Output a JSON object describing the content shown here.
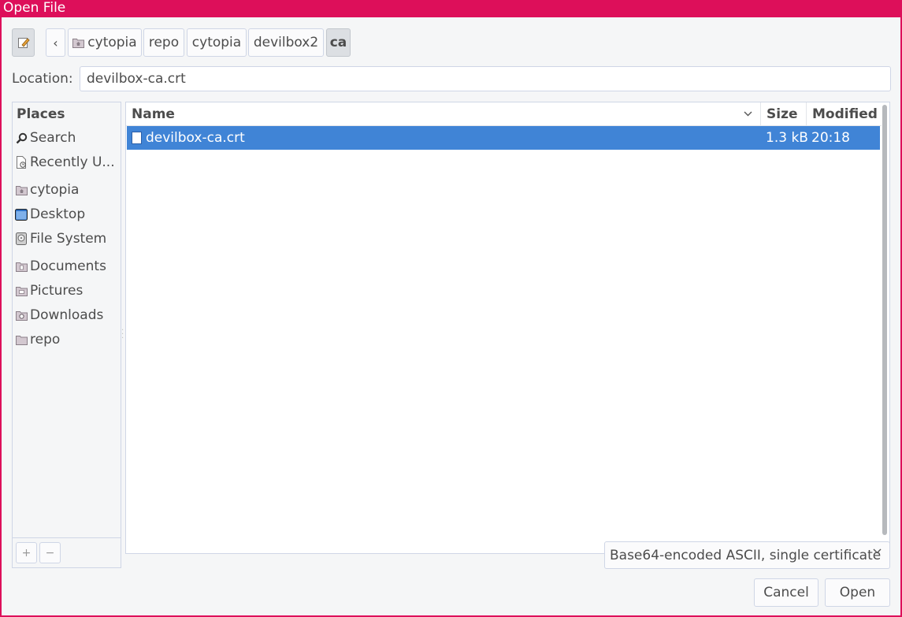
{
  "window": {
    "title": "Open File"
  },
  "pathbar": {
    "crumbs": [
      {
        "label": "cytopia",
        "icon": "home-folder-icon"
      },
      {
        "label": "repo"
      },
      {
        "label": "cytopia"
      },
      {
        "label": "devilbox2"
      },
      {
        "label": "ca"
      }
    ]
  },
  "location": {
    "label": "Location:",
    "value": "devilbox-ca.crt"
  },
  "sidebar": {
    "title": "Places",
    "items": [
      {
        "label": "Search",
        "icon": "search-icon"
      },
      {
        "label": "Recently U...",
        "icon": "recent-icon"
      },
      {
        "label": "cytopia",
        "icon": "home-folder-icon"
      },
      {
        "label": "Desktop",
        "icon": "desktop-icon"
      },
      {
        "label": "File System",
        "icon": "drive-icon"
      },
      {
        "label": "Documents",
        "icon": "documents-folder-icon"
      },
      {
        "label": "Pictures",
        "icon": "pictures-folder-icon"
      },
      {
        "label": "Downloads",
        "icon": "downloads-folder-icon"
      },
      {
        "label": "repo",
        "icon": "folder-icon"
      }
    ],
    "add_label": "+",
    "remove_label": "−"
  },
  "filelist": {
    "columns": {
      "name": "Name",
      "size": "Size",
      "modified": "Modified"
    },
    "rows": [
      {
        "name": "devilbox-ca.crt",
        "size": "1.3 kB",
        "modified": "20:18",
        "selected": true
      }
    ]
  },
  "filter": {
    "selected": "Base64-encoded ASCII, single certificate"
  },
  "buttons": {
    "cancel": "Cancel",
    "open": "Open"
  },
  "colors": {
    "titlebar": "#dd0f5a",
    "selection": "#4084d6"
  }
}
